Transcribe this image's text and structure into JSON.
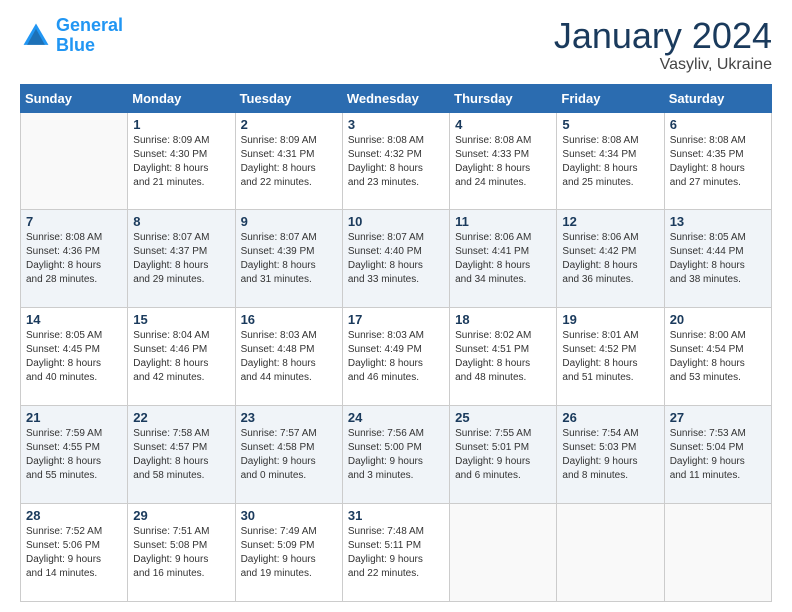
{
  "header": {
    "logo_line1": "General",
    "logo_line2": "Blue",
    "title": "January 2024",
    "subtitle": "Vasyliv, Ukraine"
  },
  "columns": [
    "Sunday",
    "Monday",
    "Tuesday",
    "Wednesday",
    "Thursday",
    "Friday",
    "Saturday"
  ],
  "weeks": [
    [
      {
        "day": "",
        "info": ""
      },
      {
        "day": "1",
        "info": "Sunrise: 8:09 AM\nSunset: 4:30 PM\nDaylight: 8 hours\nand 21 minutes."
      },
      {
        "day": "2",
        "info": "Sunrise: 8:09 AM\nSunset: 4:31 PM\nDaylight: 8 hours\nand 22 minutes."
      },
      {
        "day": "3",
        "info": "Sunrise: 8:08 AM\nSunset: 4:32 PM\nDaylight: 8 hours\nand 23 minutes."
      },
      {
        "day": "4",
        "info": "Sunrise: 8:08 AM\nSunset: 4:33 PM\nDaylight: 8 hours\nand 24 minutes."
      },
      {
        "day": "5",
        "info": "Sunrise: 8:08 AM\nSunset: 4:34 PM\nDaylight: 8 hours\nand 25 minutes."
      },
      {
        "day": "6",
        "info": "Sunrise: 8:08 AM\nSunset: 4:35 PM\nDaylight: 8 hours\nand 27 minutes."
      }
    ],
    [
      {
        "day": "7",
        "info": "Sunrise: 8:08 AM\nSunset: 4:36 PM\nDaylight: 8 hours\nand 28 minutes."
      },
      {
        "day": "8",
        "info": "Sunrise: 8:07 AM\nSunset: 4:37 PM\nDaylight: 8 hours\nand 29 minutes."
      },
      {
        "day": "9",
        "info": "Sunrise: 8:07 AM\nSunset: 4:39 PM\nDaylight: 8 hours\nand 31 minutes."
      },
      {
        "day": "10",
        "info": "Sunrise: 8:07 AM\nSunset: 4:40 PM\nDaylight: 8 hours\nand 33 minutes."
      },
      {
        "day": "11",
        "info": "Sunrise: 8:06 AM\nSunset: 4:41 PM\nDaylight: 8 hours\nand 34 minutes."
      },
      {
        "day": "12",
        "info": "Sunrise: 8:06 AM\nSunset: 4:42 PM\nDaylight: 8 hours\nand 36 minutes."
      },
      {
        "day": "13",
        "info": "Sunrise: 8:05 AM\nSunset: 4:44 PM\nDaylight: 8 hours\nand 38 minutes."
      }
    ],
    [
      {
        "day": "14",
        "info": "Sunrise: 8:05 AM\nSunset: 4:45 PM\nDaylight: 8 hours\nand 40 minutes."
      },
      {
        "day": "15",
        "info": "Sunrise: 8:04 AM\nSunset: 4:46 PM\nDaylight: 8 hours\nand 42 minutes."
      },
      {
        "day": "16",
        "info": "Sunrise: 8:03 AM\nSunset: 4:48 PM\nDaylight: 8 hours\nand 44 minutes."
      },
      {
        "day": "17",
        "info": "Sunrise: 8:03 AM\nSunset: 4:49 PM\nDaylight: 8 hours\nand 46 minutes."
      },
      {
        "day": "18",
        "info": "Sunrise: 8:02 AM\nSunset: 4:51 PM\nDaylight: 8 hours\nand 48 minutes."
      },
      {
        "day": "19",
        "info": "Sunrise: 8:01 AM\nSunset: 4:52 PM\nDaylight: 8 hours\nand 51 minutes."
      },
      {
        "day": "20",
        "info": "Sunrise: 8:00 AM\nSunset: 4:54 PM\nDaylight: 8 hours\nand 53 minutes."
      }
    ],
    [
      {
        "day": "21",
        "info": "Sunrise: 7:59 AM\nSunset: 4:55 PM\nDaylight: 8 hours\nand 55 minutes."
      },
      {
        "day": "22",
        "info": "Sunrise: 7:58 AM\nSunset: 4:57 PM\nDaylight: 8 hours\nand 58 minutes."
      },
      {
        "day": "23",
        "info": "Sunrise: 7:57 AM\nSunset: 4:58 PM\nDaylight: 9 hours\nand 0 minutes."
      },
      {
        "day": "24",
        "info": "Sunrise: 7:56 AM\nSunset: 5:00 PM\nDaylight: 9 hours\nand 3 minutes."
      },
      {
        "day": "25",
        "info": "Sunrise: 7:55 AM\nSunset: 5:01 PM\nDaylight: 9 hours\nand 6 minutes."
      },
      {
        "day": "26",
        "info": "Sunrise: 7:54 AM\nSunset: 5:03 PM\nDaylight: 9 hours\nand 8 minutes."
      },
      {
        "day": "27",
        "info": "Sunrise: 7:53 AM\nSunset: 5:04 PM\nDaylight: 9 hours\nand 11 minutes."
      }
    ],
    [
      {
        "day": "28",
        "info": "Sunrise: 7:52 AM\nSunset: 5:06 PM\nDaylight: 9 hours\nand 14 minutes."
      },
      {
        "day": "29",
        "info": "Sunrise: 7:51 AM\nSunset: 5:08 PM\nDaylight: 9 hours\nand 16 minutes."
      },
      {
        "day": "30",
        "info": "Sunrise: 7:49 AM\nSunset: 5:09 PM\nDaylight: 9 hours\nand 19 minutes."
      },
      {
        "day": "31",
        "info": "Sunrise: 7:48 AM\nSunset: 5:11 PM\nDaylight: 9 hours\nand 22 minutes."
      },
      {
        "day": "",
        "info": ""
      },
      {
        "day": "",
        "info": ""
      },
      {
        "day": "",
        "info": ""
      }
    ]
  ]
}
